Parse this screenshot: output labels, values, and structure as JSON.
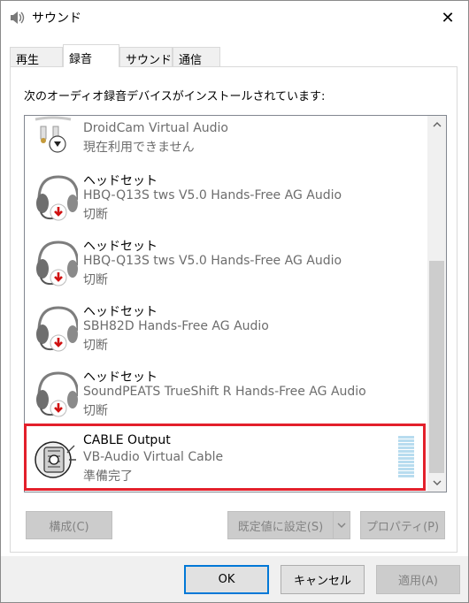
{
  "window": {
    "title": "サウンド",
    "close_glyph": "✕"
  },
  "tabs": [
    {
      "label": "再生"
    },
    {
      "label": "録音"
    },
    {
      "label": "サウンド"
    },
    {
      "label": "通信"
    }
  ],
  "instruction": "次のオーディオ録音デバイスがインストールされています:",
  "devices": [
    {
      "name": "DroidCam Virtual Audio",
      "detail": "現在利用できません",
      "icon": "cable-icon"
    },
    {
      "name": "ヘッドセット",
      "detail": "HBQ-Q13S tws V5.0 Hands-Free AG Audio",
      "status": "切断",
      "icon": "headset-icon"
    },
    {
      "name": "ヘッドセット",
      "detail": "HBQ-Q13S tws V5.0 Hands-Free AG Audio",
      "status": "切断",
      "icon": "headset-icon"
    },
    {
      "name": "ヘッドセット",
      "detail": "SBH82D Hands-Free AG Audio",
      "status": "切断",
      "icon": "headset-icon"
    },
    {
      "name": "ヘッドセット",
      "detail": "SoundPEATS TrueShift R Hands-Free AG Audio",
      "status": "切断",
      "icon": "headset-icon"
    },
    {
      "name": "CABLE Output",
      "detail": "VB-Audio Virtual Cable",
      "status": "準備完了",
      "icon": "virtual-cable-icon"
    }
  ],
  "buttons": {
    "configure": "構成(C)",
    "set_default": "既定値に設定(S)",
    "properties": "プロパティ(P)",
    "ok": "OK",
    "cancel": "キャンセル",
    "apply": "適用(A)"
  },
  "colors": {
    "highlight_border": "#e3202b",
    "ok_border": "#0078d7"
  }
}
